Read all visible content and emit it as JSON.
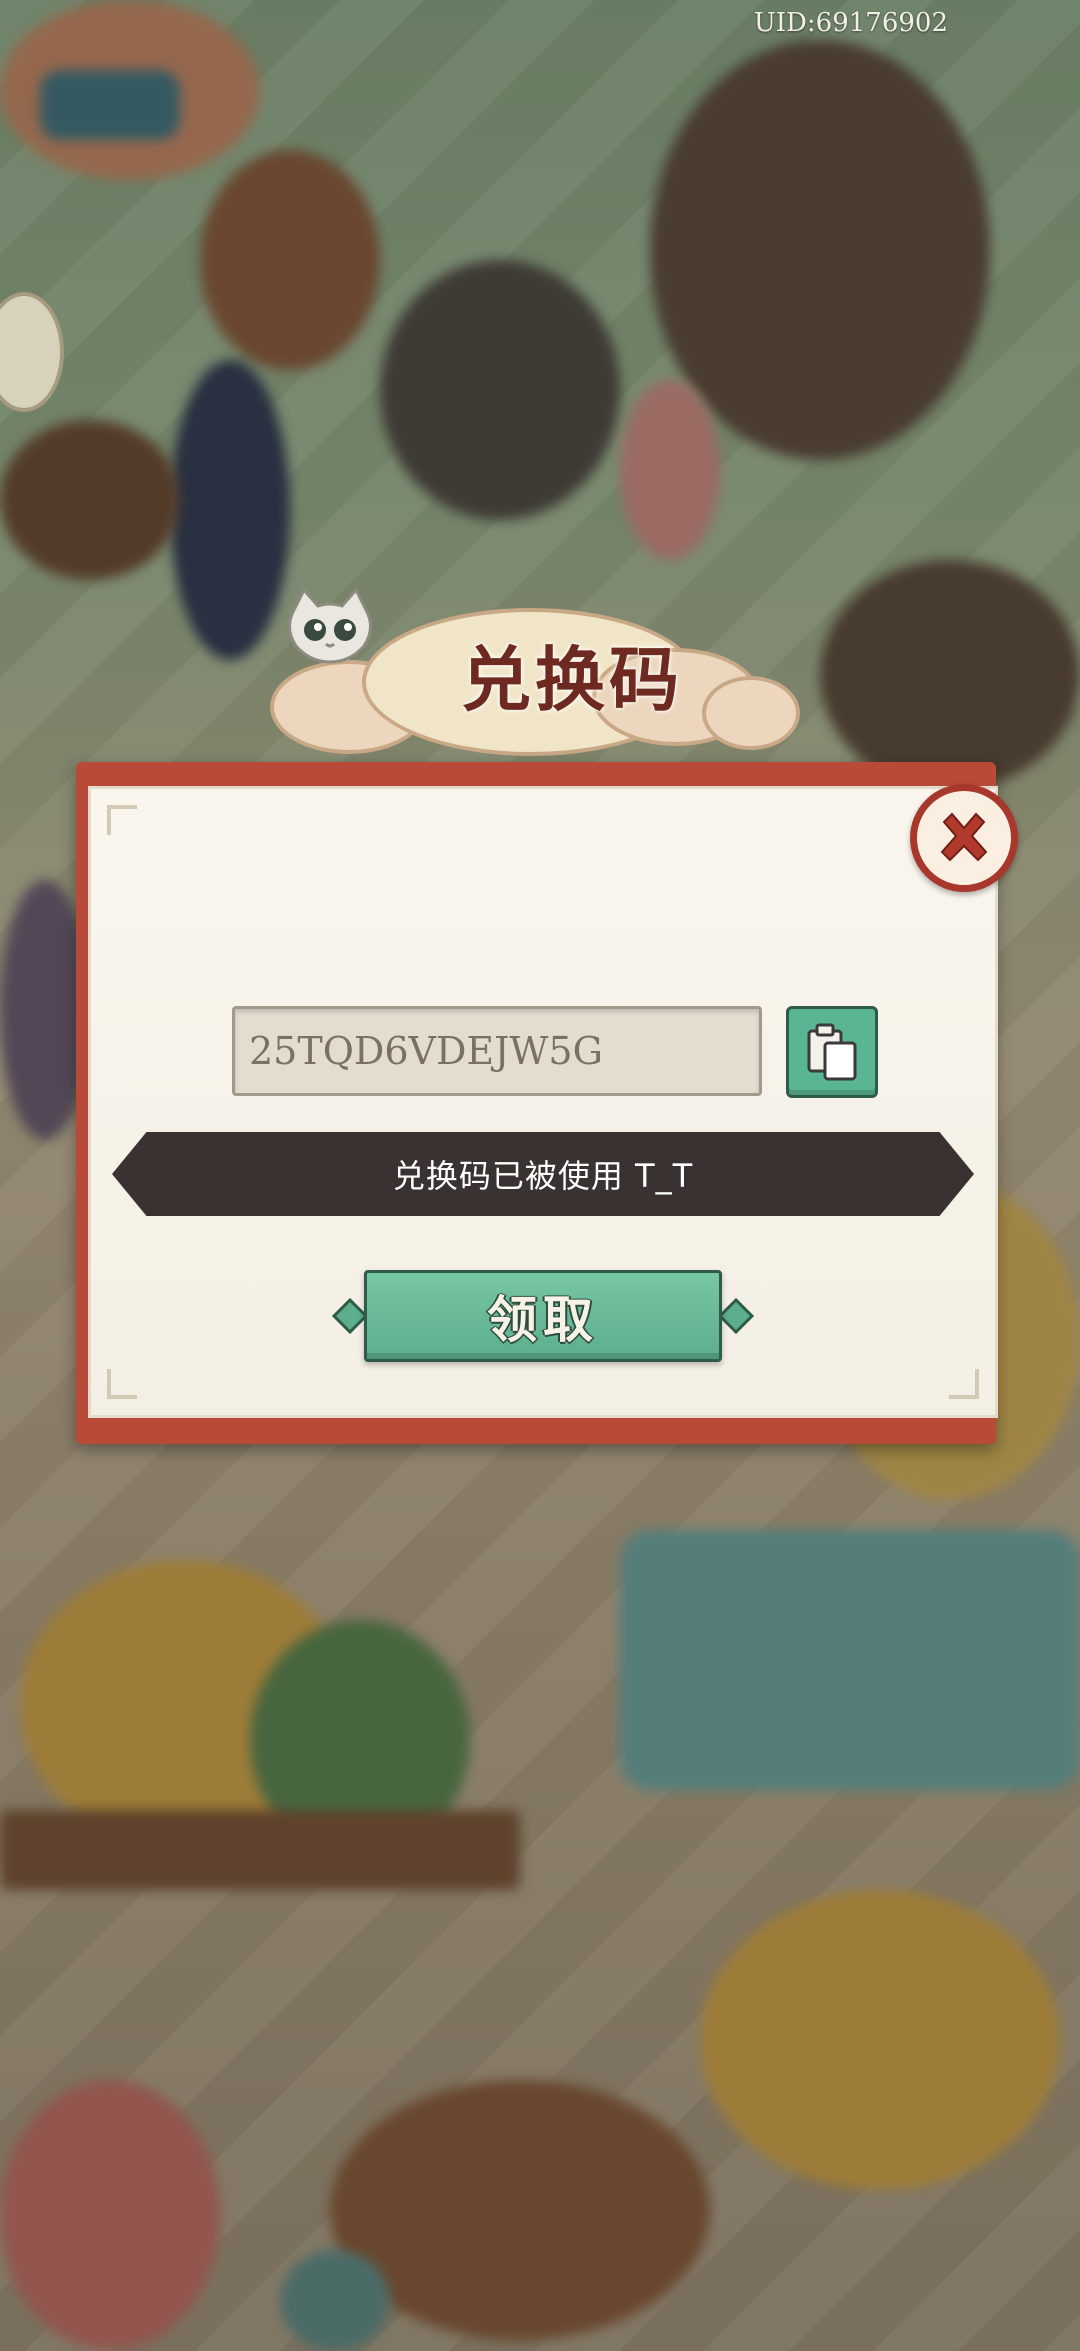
{
  "header": {
    "uid": "UID:69176902"
  },
  "dialog": {
    "title": "兑换码",
    "code_value": "25TQD6VDEJW5G",
    "status_message": "兑换码已被使用 T_T",
    "claim_label": "领取"
  },
  "icons": {
    "close": "close-icon",
    "paste": "paste-clipboard-icon",
    "mascot": "cat-mascot-icon"
  },
  "colors": {
    "frame": "#b84a37",
    "paper": "#faf6ee",
    "accent_green": "#5cae8c",
    "banner": "#3a3231",
    "title": "#6e2a21"
  }
}
